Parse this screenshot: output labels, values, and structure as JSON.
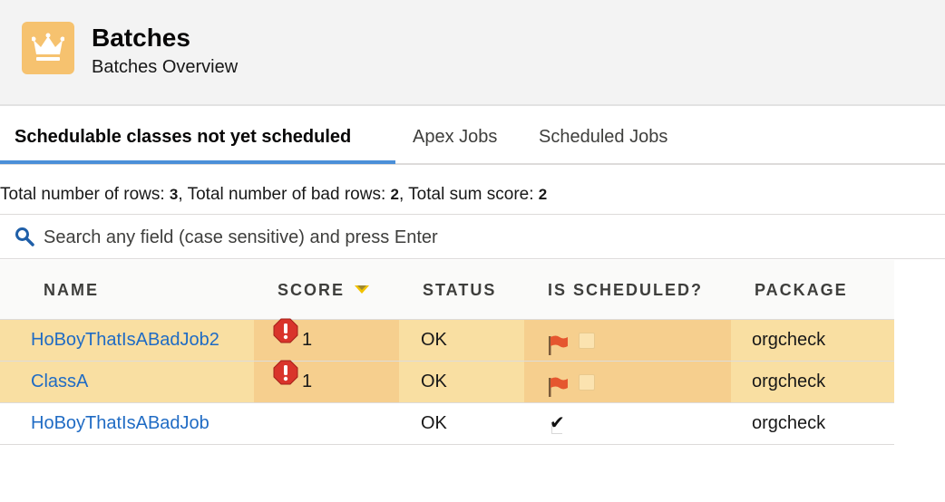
{
  "header": {
    "title": "Batches",
    "subtitle": "Batches Overview",
    "icon": "crown-icon",
    "accent_color": "#f6c26f"
  },
  "tabs": [
    {
      "label": "Schedulable classes not yet scheduled",
      "active": true
    },
    {
      "label": "Apex Jobs",
      "active": false
    },
    {
      "label": "Scheduled Jobs",
      "active": false
    }
  ],
  "summary": {
    "rows_label": "Total number of rows: ",
    "rows_value": "3",
    "bad_rows_label": ", Total number of bad rows: ",
    "bad_rows_value": "2",
    "sum_score_label": ", Total sum score: ",
    "sum_score_value": "2"
  },
  "search": {
    "placeholder": "Search any field (case sensitive) and press Enter",
    "value": ""
  },
  "table": {
    "columns": [
      "NAME",
      "SCORE",
      "STATUS",
      "IS SCHEDULED?",
      "PACKAGE"
    ],
    "sorted_column": "SCORE",
    "rows": [
      {
        "name": "HoBoyThatIsABadJob2",
        "score": "1",
        "status": "OK",
        "is_scheduled": false,
        "package": "orgcheck",
        "bad": true
      },
      {
        "name": "ClassA",
        "score": "1",
        "status": "OK",
        "is_scheduled": false,
        "package": "orgcheck",
        "bad": true
      },
      {
        "name": "HoBoyThatIsABadJob",
        "score": "",
        "status": "OK",
        "is_scheduled": true,
        "package": "orgcheck",
        "bad": false
      }
    ]
  },
  "colors": {
    "bad_row": "#f9dfa2",
    "bad_cell": "#f6cf8e",
    "link": "#1f6bc4",
    "tab_underline": "#4b8fd8",
    "error": "#d9342b",
    "flag": "#e5562f"
  }
}
